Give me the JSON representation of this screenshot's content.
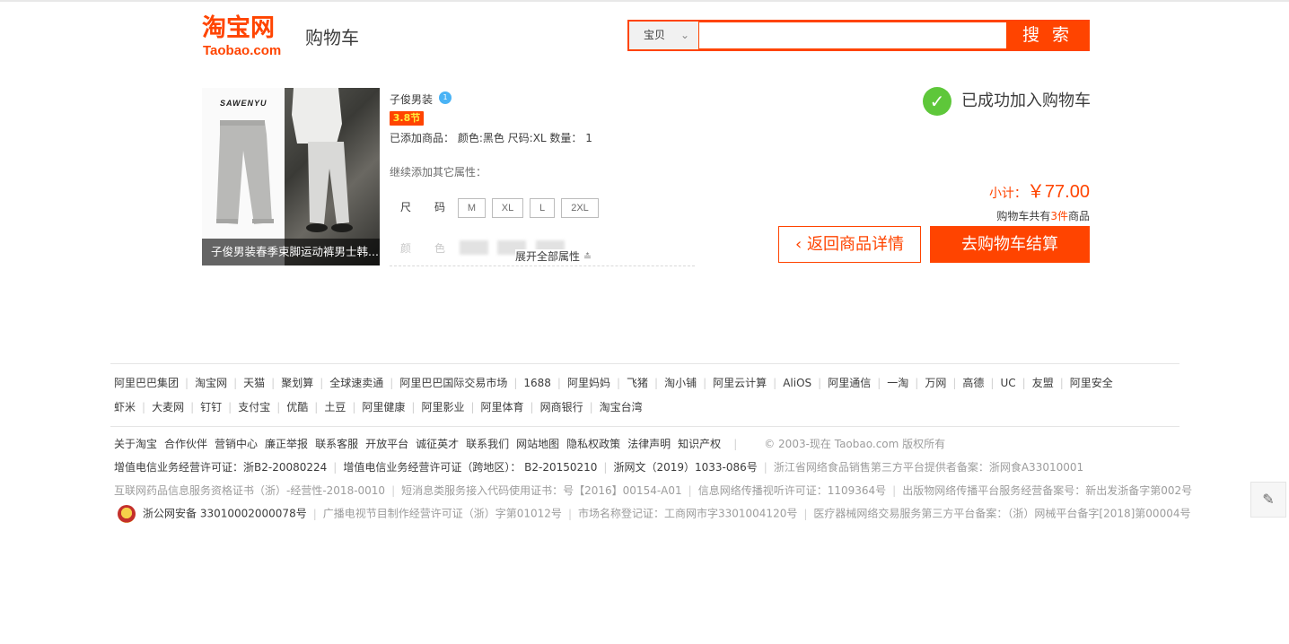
{
  "header": {
    "logo_cn": "淘宝网",
    "logo_en": "Taobao.com",
    "page_label": "购物车",
    "search_type": "宝贝",
    "search_value": "",
    "search_button": "搜 索"
  },
  "product": {
    "image_brand": "SAWENYU",
    "image_caption": "子俊男装春季束脚运动裤男士韩...",
    "shop_name": "子俊男装",
    "shop_badge": "1",
    "promo_label": "3.8节",
    "added_info": "已添加商品： 颜色:黑色 尺码:XL 数量： 1",
    "more_attr_label": "继续添加其它属性：",
    "size_attr_name_1": "尺",
    "size_attr_name_2": "码",
    "size_options": [
      "M",
      "XL",
      "L",
      "2XL"
    ],
    "color_attr_name_1": "颜",
    "color_attr_name_2": "色",
    "expand_label": "展开全部属性",
    "expand_icon": "double-chevron-down-icon"
  },
  "result": {
    "success_text": "已成功加入购物车",
    "success_icon": "check-circle-icon",
    "subtotal_label": "小计：",
    "subtotal_amount": "￥77.00",
    "cart_count_prefix": "购物车共有",
    "cart_count_value": "3件",
    "cart_count_suffix": "商品",
    "back_button": "返回商品详情",
    "back_icon": "chevron-left-icon",
    "checkout_button": "去购物车结算"
  },
  "footer": {
    "links_row1": [
      "阿里巴巴集团",
      "淘宝网",
      "天猫",
      "聚划算",
      "全球速卖通",
      "阿里巴巴国际交易市场",
      "1688",
      "阿里妈妈",
      "飞猪",
      "淘小铺",
      "阿里云计算",
      "AliOS",
      "阿里通信",
      "一淘",
      "万网",
      "高德",
      "UC",
      "友盟",
      "阿里安全"
    ],
    "links_row2": [
      "虾米",
      "大麦网",
      "钉钉",
      "支付宝",
      "优酷",
      "土豆",
      "阿里健康",
      "阿里影业",
      "阿里体育",
      "网商银行",
      "淘宝台湾"
    ],
    "about_links": [
      "关于淘宝",
      "合作伙伴",
      "营销中心",
      "廉正举报",
      "联系客服",
      "开放平台",
      "诚征英才",
      "联系我们",
      "网站地图",
      "隐私权政策",
      "法律声明",
      "知识产权"
    ],
    "copyright": "© 2003-现在 Taobao.com 版权所有",
    "license_row1": [
      "增值电信业务经营许可证：浙B2-20080224",
      "增值电信业务经营许可证（跨地区）： B2-20150210",
      "浙网文（2019）1033-086号",
      "浙江省网络食品销售第三方平台提供者备案：浙网食A33010001"
    ],
    "license_row2": [
      "互联网药品信息服务资格证书（浙）-经营性-2018-0010",
      "短消息类服务接入代码使用证书：号【2016】00154-A01",
      "信息网络传播视听许可证：1109364号",
      "出版物网络传播平台服务经营备案号：新出发浙备字第002号"
    ],
    "license_row3": [
      "浙公网安备 33010002000078号",
      "广播电视节目制作经营许可证（浙）字第01012号",
      "市场名称登记证：工商网市字3301004120号",
      "医疗器械网络交易服务第三方平台备案：（浙）网械平台备字[2018]第00004号"
    ]
  },
  "side_tool": {
    "icon": "pencil-icon"
  }
}
